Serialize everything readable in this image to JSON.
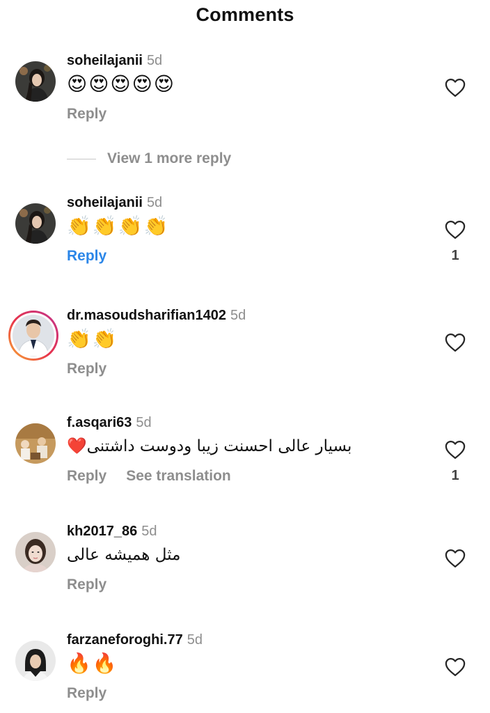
{
  "header": {
    "title": "Comments"
  },
  "view_more_reply": "View 1 more reply",
  "comments": [
    {
      "username": "soheilajanii",
      "time": "5d",
      "text": "😍😍😍😍😍",
      "reply": "Reply",
      "likes": ""
    },
    {
      "username": "soheilajanii",
      "time": "5d",
      "text": "👏👏👏👏",
      "reply": "Reply",
      "likes": "1"
    },
    {
      "username": "dr.masoudsharifian1402",
      "time": "5d",
      "text": "👏👏",
      "reply": "Reply",
      "likes": ""
    },
    {
      "username": "f.asqari63",
      "time": "5d",
      "text": "بسیار عالی احسنت زیبا ودوست داشتنی❤️",
      "reply": "Reply",
      "see_translation": "See translation",
      "likes": "1"
    },
    {
      "username": "kh2017_86",
      "time": "5d",
      "text": "مثل همیشه عالی",
      "reply": "Reply",
      "likes": ""
    },
    {
      "username": "farzaneforoghi.77",
      "time": "5d",
      "text": "🔥🔥",
      "reply": "Reply",
      "likes": ""
    }
  ],
  "icons": {
    "like": "heart-outline-icon",
    "avatar": "profile-picture"
  },
  "colors": {
    "reply_active": "#2b86e8",
    "secondary_text": "#8e8e8e",
    "story_ring_start": "#f9b233",
    "story_ring_end": "#c1358e"
  }
}
